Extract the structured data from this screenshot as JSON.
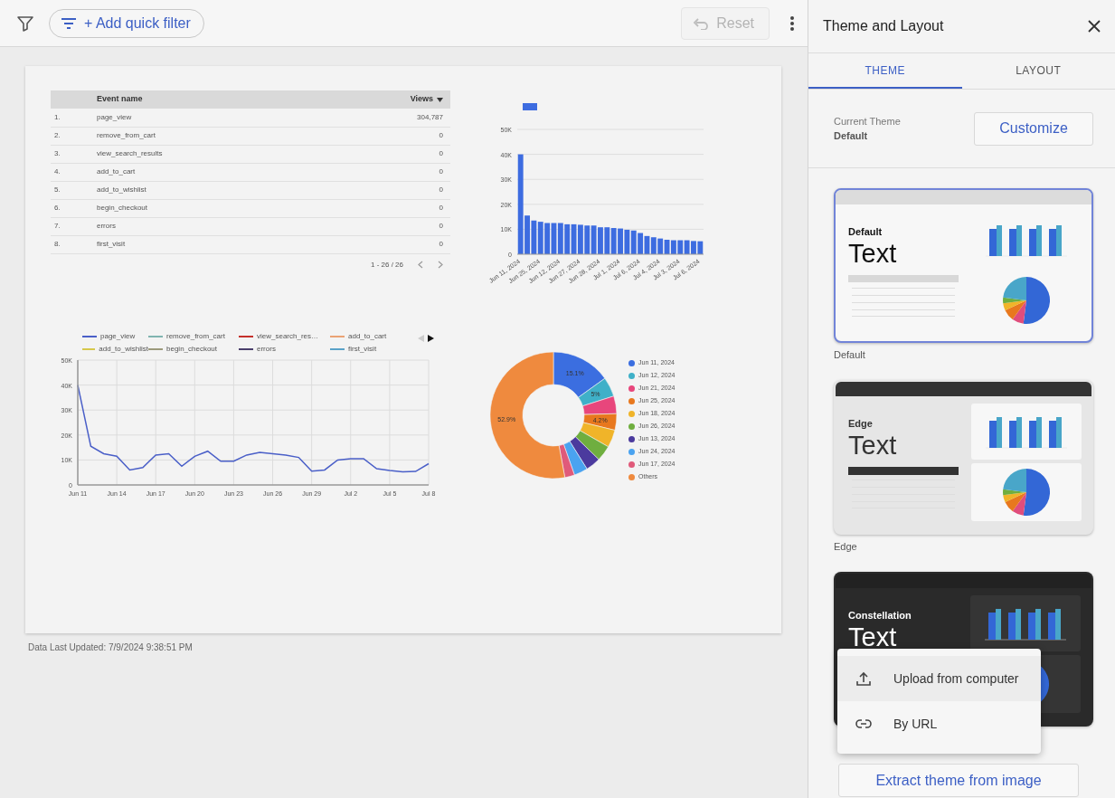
{
  "toolbar": {
    "quick_filter": "+ Add quick filter",
    "reset": {
      "label": "Reset",
      "disabled": true
    }
  },
  "report": {
    "table": {
      "columns": [
        "Event name",
        "Views"
      ],
      "rows": [
        {
          "index": "1.",
          "name": "page_view",
          "views": "304,787"
        },
        {
          "index": "2.",
          "name": "remove_from_cart",
          "views": "0"
        },
        {
          "index": "3.",
          "name": "view_search_results",
          "views": "0"
        },
        {
          "index": "4.",
          "name": "add_to_cart",
          "views": "0"
        },
        {
          "index": "5.",
          "name": "add_to_wishlist",
          "views": "0"
        },
        {
          "index": "6.",
          "name": "begin_checkout",
          "views": "0"
        },
        {
          "index": "7.",
          "name": "errors",
          "views": "0"
        },
        {
          "index": "8.",
          "name": "first_visit",
          "views": "0"
        }
      ],
      "pagination": "1 - 26 / 26"
    },
    "bar_chart": {
      "chart_data": {
        "type": "bar",
        "grid": true,
        "categories": [
          "Jun 11, 2024",
          null,
          null,
          "Jun 25, 2024",
          null,
          null,
          "Jun 12, 2024",
          null,
          null,
          "Jun 27, 2024",
          null,
          null,
          "Jun 28, 2024",
          null,
          null,
          "Jul 1, 2024",
          null,
          null,
          "Jul 6, 2024",
          null,
          null,
          "Jul 4, 2024",
          null,
          null,
          "Jul 3, 2024",
          null,
          null,
          "Jul 6, 2024"
        ],
        "series": [
          {
            "color": "#3d6ce0",
            "values": [
              40000,
              15500,
              13500,
              13000,
              12500,
              12500,
              12500,
              12000,
              12000,
              11800,
              11500,
              11500,
              10800,
              10800,
              10500,
              10300,
              9800,
              9500,
              8500,
              7300,
              6800,
              6300,
              5800,
              5600,
              5600,
              5600,
              5300,
              5200
            ]
          }
        ],
        "ylim": [
          0,
          50000
        ],
        "yticks": [
          {
            "value": 0,
            "label": "0"
          },
          {
            "value": 10000,
            "label": "10K"
          },
          {
            "value": 20000,
            "label": "20K"
          },
          {
            "value": 30000,
            "label": "30K"
          },
          {
            "value": 40000,
            "label": "40K"
          },
          {
            "value": 50000,
            "label": "50K"
          }
        ]
      }
    },
    "line_chart": {
      "chart_data": {
        "type": "line",
        "grid": true,
        "legend": true,
        "categories": [
          "Jun 11",
          null,
          null,
          "Jun 14",
          null,
          null,
          "Jun 17",
          null,
          null,
          "Jun 20",
          null,
          null,
          "Jun 23",
          null,
          null,
          "Jun 26",
          null,
          null,
          "Jun 29",
          null,
          null,
          "Jul 2",
          null,
          null,
          "Jul 5",
          null,
          null,
          "Jul 8"
        ],
        "ylim": [
          0,
          50000
        ],
        "yticks": [
          {
            "value": 0,
            "label": "0"
          },
          {
            "value": 10000,
            "label": "10K"
          },
          {
            "value": 20000,
            "label": "20K"
          },
          {
            "value": 30000,
            "label": "30K"
          },
          {
            "value": 40000,
            "label": "40K"
          },
          {
            "value": 50000,
            "label": "50K"
          }
        ],
        "series": [
          {
            "name": "page_view",
            "color": "#4a5fc8",
            "values": [
              40000,
              15500,
              12500,
              11500,
              6000,
              7000,
              12000,
              12500,
              7500,
              11500,
              13500,
              9500,
              9500,
              12000,
              13000,
              12500,
              12000,
              11000,
              5500,
              6000,
              10000,
              10500,
              10500,
              6500,
              5800,
              5300,
              5400,
              8500
            ]
          },
          {
            "name": "remove_from_cart",
            "color": "#80b4b0",
            "values": [
              null,
              null,
              null,
              null,
              null,
              null,
              null,
              null,
              null,
              null,
              null,
              null,
              null,
              null,
              null,
              null,
              null,
              null,
              null,
              null,
              null,
              null,
              null,
              null,
              null,
              null,
              null,
              null
            ]
          },
          {
            "name": "view_search_res…",
            "color": "#c4302b",
            "values": [
              null,
              null,
              null,
              null,
              null,
              null,
              null,
              null,
              null,
              null,
              null,
              null,
              null,
              null,
              null,
              null,
              null,
              null,
              null,
              null,
              null,
              null,
              null,
              null,
              null,
              null,
              null,
              null
            ]
          },
          {
            "name": "add_to_cart",
            "color": "#eaa274",
            "values": [
              null,
              null,
              null,
              null,
              null,
              null,
              null,
              null,
              null,
              null,
              null,
              null,
              null,
              null,
              null,
              null,
              null,
              null,
              null,
              null,
              null,
              null,
              null,
              null,
              null,
              null,
              null,
              null
            ]
          },
          {
            "name": "add_to_wishlist",
            "color": "#d6c84c",
            "values": [
              null,
              null,
              null,
              null,
              null,
              null,
              null,
              null,
              null,
              null,
              null,
              null,
              null,
              null,
              null,
              null,
              null,
              null,
              null,
              null,
              null,
              null,
              null,
              null,
              null,
              null,
              null,
              null
            ]
          },
          {
            "name": "begin_checkout",
            "color": "#9c9a7c",
            "values": [
              null,
              null,
              null,
              null,
              null,
              null,
              null,
              null,
              null,
              null,
              null,
              null,
              null,
              null,
              null,
              null,
              null,
              null,
              null,
              null,
              null,
              null,
              null,
              null,
              null,
              null,
              null,
              null
            ]
          },
          {
            "name": "errors",
            "color": "#4a3f6b",
            "values": [
              null,
              null,
              null,
              null,
              null,
              null,
              null,
              null,
              null,
              null,
              null,
              null,
              null,
              null,
              null,
              null,
              null,
              null,
              null,
              null,
              null,
              null,
              null,
              null,
              null,
              null,
              null,
              null
            ]
          },
          {
            "name": "first_visit",
            "color": "#5aa2c8",
            "values": [
              null,
              null,
              null,
              null,
              null,
              null,
              null,
              null,
              null,
              null,
              null,
              null,
              null,
              null,
              null,
              null,
              null,
              null,
              null,
              null,
              null,
              null,
              null,
              null,
              null,
              null,
              null,
              null
            ]
          }
        ]
      }
    },
    "donut_chart": {
      "chart_data": {
        "type": "donut",
        "legend": true,
        "categories": [
          "Jun 11, 2024",
          "Jun 12, 2024",
          "Jun 21, 2024",
          "Jun 25, 2024",
          "Jun 18, 2024",
          "Jun 26, 2024",
          "Jun 13, 2024",
          "Jun 24, 2024",
          "Jun 17, 2024",
          "Others"
        ],
        "values": [
          15.1,
          5,
          4.5,
          4.2,
          4.5,
          4,
          3.8,
          3.5,
          2.5,
          52.9
        ],
        "value_labels": [
          "15.1%",
          "5%",
          null,
          "4.2%",
          null,
          null,
          null,
          null,
          null,
          "52.9%"
        ]
      },
      "slices": [
        {
          "color": "#3b6ee0"
        },
        {
          "color": "#3fb0c8"
        },
        {
          "color": "#e8467c"
        },
        {
          "color": "#e8781e"
        },
        {
          "color": "#f0b429"
        },
        {
          "color": "#6fae3f"
        },
        {
          "color": "#4b3a9e"
        },
        {
          "color": "#4aa3f0"
        },
        {
          "color": "#e05a7a"
        },
        {
          "color": "#ef8a3e"
        }
      ]
    },
    "last_updated": "Data Last Updated: 7/9/2024 9:38:51 PM"
  },
  "panel": {
    "title": "Theme and Layout",
    "tabs": [
      {
        "label": "THEME",
        "selected": true
      },
      {
        "label": "LAYOUT",
        "selected": false
      }
    ],
    "current_theme": {
      "label": "Current Theme",
      "value": "Default"
    },
    "customize": "Customize",
    "themes": [
      {
        "kind": "default",
        "preview_title": "Default",
        "preview_sample": "Text",
        "label": "Default",
        "selected": true
      },
      {
        "kind": "edge",
        "preview_title": "Edge",
        "preview_sample": "Text",
        "label": "Edge",
        "selected": false
      },
      {
        "kind": "constellation",
        "preview_title": "Constellation",
        "preview_sample": "Text",
        "selected": false
      }
    ],
    "menu": [
      {
        "kind": "upload",
        "label": "Upload from computer"
      },
      {
        "kind": "link",
        "label": "By URL"
      }
    ],
    "extract": "Extract theme from image"
  }
}
